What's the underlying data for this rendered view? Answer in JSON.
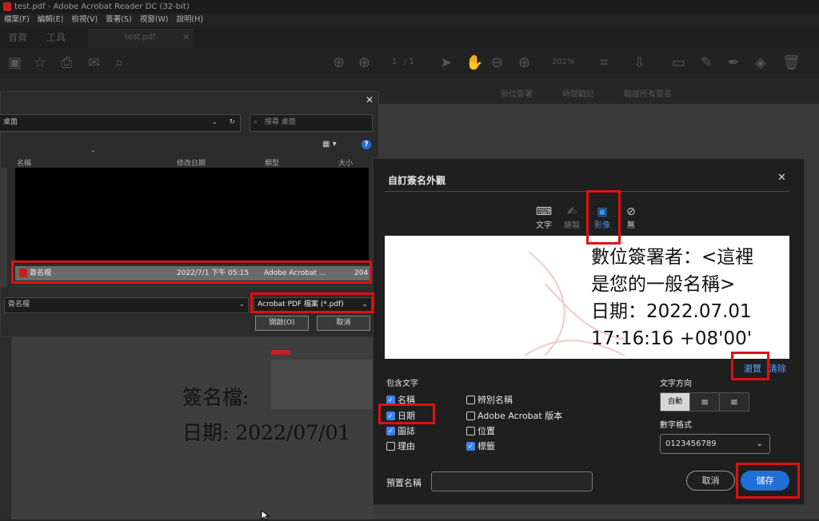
{
  "titlebar": {
    "text": "test.pdf - Adobe Acrobat Reader DC (32-bit)"
  },
  "menubar": {
    "items": [
      "檔案(F)",
      "編輯(E)",
      "檢視(V)",
      "簽署(S)",
      "視窗(W)",
      "說明(H)"
    ]
  },
  "tabs": {
    "home": "首頁",
    "tools": "工具",
    "doc": "test.pdf"
  },
  "toolbar": {
    "page_current": "1",
    "page_total": "/ 1",
    "zoom": "202%"
  },
  "subbar": {
    "item1": "新位簽署",
    "item2": "時間戳記",
    "item3": "驗證所有簽名"
  },
  "document": {
    "line1": "簽名檔:",
    "line2": "日期: 2022/07/01"
  },
  "file_dialog": {
    "location": "桌面",
    "search_placeholder": "搜尋 桌面",
    "columns": [
      "名稱",
      "修改日期",
      "類型",
      "大小"
    ],
    "file": {
      "name": "簽名檔",
      "modified": "2022/7/1 下午 05:15",
      "type": "Adobe Acrobat ...",
      "size": "204"
    },
    "filename_value": "簽名檔",
    "filetype": "Acrobat PDF 檔案 (*.pdf)",
    "open_label": "開啟(O)",
    "cancel_label": "取消",
    "help": "?",
    "close": "✕"
  },
  "sig_dialog": {
    "title": "自訂簽名外觀",
    "close": "✕",
    "tabs": {
      "text": "文字",
      "draw": "繪製",
      "image": "影像",
      "none": "無"
    },
    "preview": {
      "line1": "數位簽署者：<這裡",
      "line2": "是您的一般名稱>",
      "line3": "日期：2022.07.01",
      "line4": "17:16:16 +08'00'"
    },
    "browse": "瀏覽",
    "clear": "清除",
    "include_text_label": "包含文字",
    "options": {
      "name": "名稱",
      "distinguished": "辨別名稱",
      "date": "日期",
      "acrobat_version": "Adobe Acrobat 版本",
      "logo": "圖誌",
      "location": "位置",
      "reason": "理由",
      "labels": "標籤"
    },
    "text_direction_label": "文字方向",
    "auto": "自動",
    "digit_format_label": "數字格式",
    "digit_format_value": "0123456789",
    "preset_name_label": "預置名稱",
    "preset_name_value": "",
    "cancel": "取消",
    "save": "儲存"
  },
  "colors": {
    "accent": "#1f6fd6",
    "highlight": "#e01010"
  }
}
